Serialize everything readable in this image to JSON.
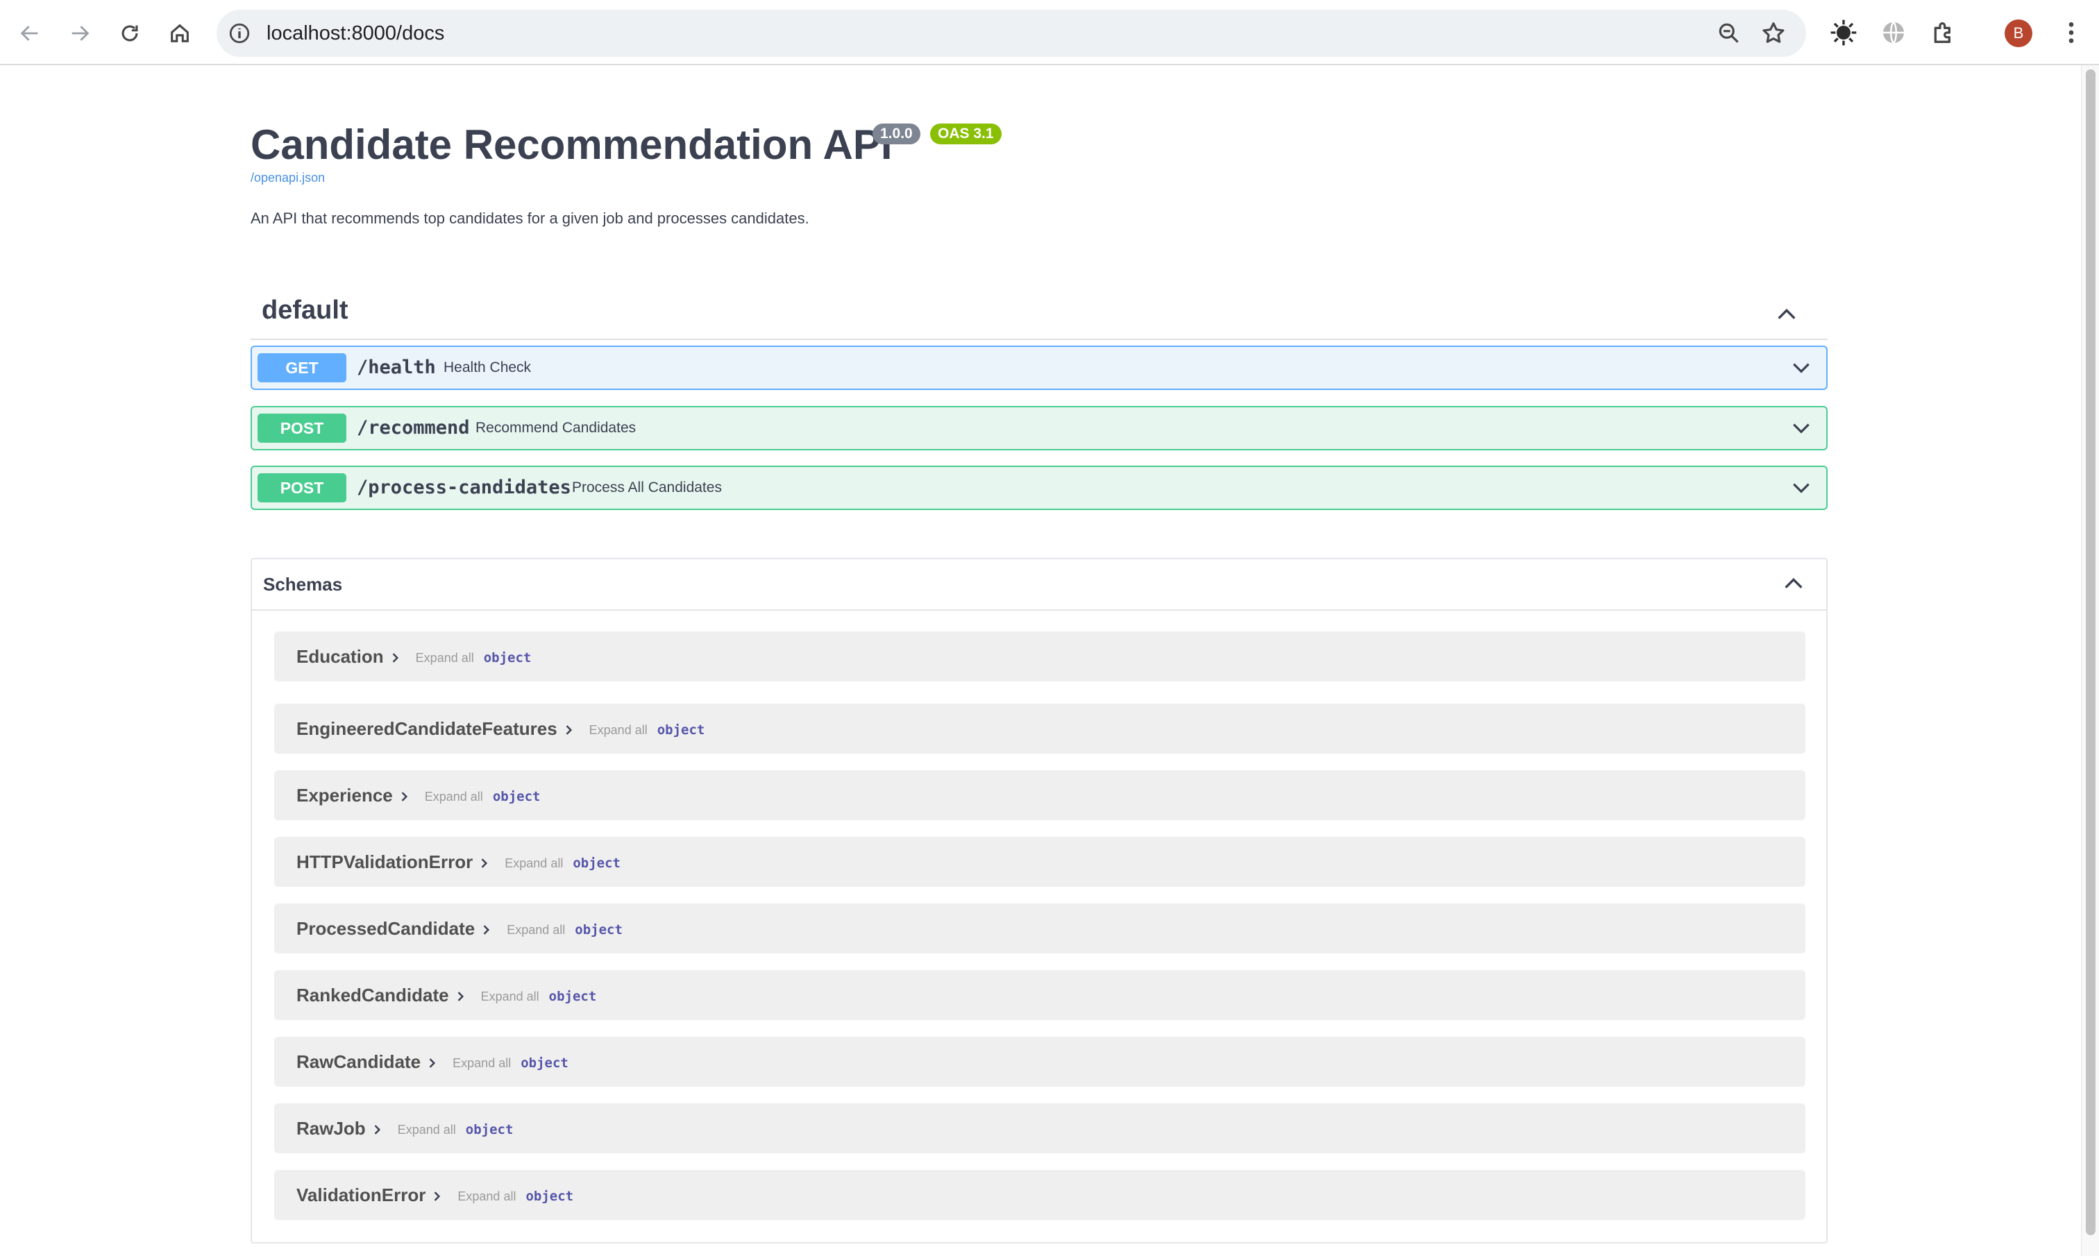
{
  "browser": {
    "url": "localhost:8000/docs",
    "profile_initial": "B"
  },
  "api": {
    "title": "Candidate Recommendation API",
    "version": "1.0.0",
    "oas": "OAS 3.1",
    "spec_link": "/openapi.json",
    "description": "An API that recommends top candidates for a given job and processes candidates."
  },
  "section": {
    "title": "default"
  },
  "operations": [
    {
      "method": "GET",
      "path": "/health",
      "summary": "Health Check"
    },
    {
      "method": "POST",
      "path": "/recommend",
      "summary": "Recommend Candidates"
    },
    {
      "method": "POST",
      "path": "/process-candidates",
      "summary": "Process All Candidates"
    }
  ],
  "schemas": {
    "title": "Schemas",
    "expand_label": "Expand all",
    "type_label": "object",
    "items": [
      "Education",
      "EngineeredCandidateFeatures",
      "Experience",
      "HTTPValidationError",
      "ProcessedCandidate",
      "RankedCandidate",
      "RawCandidate",
      "RawJob",
      "ValidationError"
    ]
  },
  "colors": {
    "get": "#61affe",
    "post": "#49cc90",
    "version_badge": "#7d8492",
    "oas_badge": "#89bf04",
    "link": "#4990e2"
  }
}
